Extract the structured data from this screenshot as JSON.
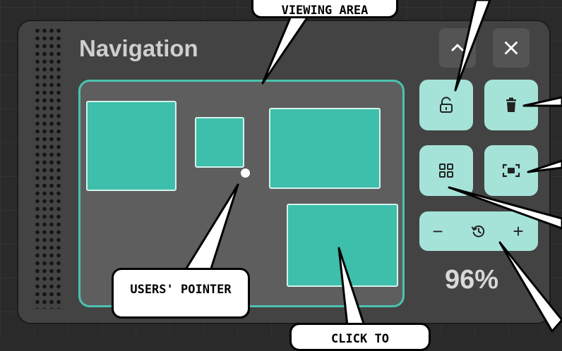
{
  "panel": {
    "title": "Navigation",
    "collapse_icon": "chevron-up-icon",
    "close_icon": "close-icon"
  },
  "toolbar": {
    "lock_icon": "unlock-icon",
    "delete_icon": "trash-icon",
    "grid_icon": "grid-icon",
    "fit_icon": "fit-screen-icon"
  },
  "zoom": {
    "minus": "−",
    "plus": "+",
    "reset_icon": "history-icon",
    "value": "96%"
  },
  "callouts": {
    "viewing_area": "VIEWING AREA",
    "users_pointer": "USERS' POINTER",
    "click_to": "CLICK TO"
  },
  "colors": {
    "accent": "#3dbfab",
    "button": "#a5e3d8",
    "panel": "#434343"
  }
}
